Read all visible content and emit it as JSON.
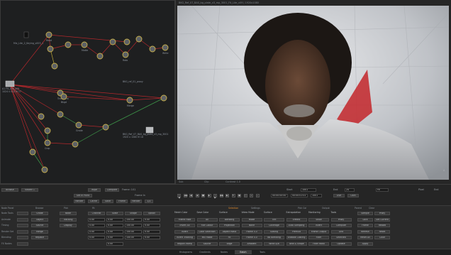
{
  "colors": {
    "accent": "#e08a2c",
    "panel": "#1e1f20",
    "edge_red": "#b2272b",
    "edge_green": "#3f9a4a",
    "edge_yellow": "#b8a234"
  },
  "node_graph": {
    "nodes": [
      "Read",
      "Merge",
      "Transform",
      "Matte",
      "Bkgd",
      "Grade",
      "Roto",
      "Blur",
      "Crop",
      "Write"
    ],
    "info_lines": [
      "Mix_Lite_2_Keying_v003_1",
      "BKG_ref_01_proxy",
      "A1 Flt_Lite_v09",
      "1024 x 512 M 17",
      "BKG_Ref_07_BAS_bg_plate_v3_mp_3001",
      "1920 x 1080 M 16"
    ]
  },
  "viewer": {
    "header_text": "BKG_Ref_07_BAS_bg_plate_v3_mp_3001_Flt_Lite_v09 | 1920x1080",
    "footer_left": "Sub",
    "footer_mid": "Clip",
    "footer_right": "Contrast 1.0",
    "corner_label": "A"
  },
  "transport": {
    "row1": {
      "a": "Browse",
      "b": "Viewer 1",
      "c": "Wipe",
      "d": "Compare",
      "e": "Frame: 101",
      "frame": "1001",
      "fps": "24",
      "zoom": "Fit",
      "start_label": "Start",
      "end_label": "End",
      "pixel_label": "Pixel",
      "last_label": "End"
    },
    "row2": {
      "set": "Set In Point",
      "frame_in": "Frame In",
      "in_value": "00:00:00:00",
      "out_value": "00:00:01:01",
      "range": "1001",
      "right1": "Live",
      "right2": "Gain"
    },
    "row3": {
      "a": "Render",
      "b": "Cache",
      "c": "Save",
      "d": "Frame",
      "e": "Render",
      "f": "1/2"
    }
  },
  "params": {
    "header": [
      "Node Panel",
      "Browse",
      "Pick",
      "Fit",
      "Selection",
      "Settings",
      "Pick Col",
      "Output",
      "Parent",
      "Clear"
    ],
    "rows": [
      {
        "label": "Node Tools",
        "cells": [
          "Grade",
          "Node",
          "Channel",
          "Scale",
          "Shape",
          "Option"
        ]
      },
      {
        "label": "Animate",
        "cells": [
          "Object",
          "Tracking",
          "0.00",
          "0.00",
          "100.00",
          "0.00"
        ]
      },
      {
        "label": "Timing",
        "cells": [
          "Source",
          "Display",
          "0.00",
          "0.00",
          "100.00",
          "0.00"
        ]
      },
      {
        "label": "Render Set",
        "cells": [
          "Merge",
          "",
          "0.00",
          "0.00",
          "100.00",
          "0.00"
        ]
      },
      {
        "label": "Blending",
        "cells": [
          "Replace",
          "",
          "0.00",
          "0.00",
          "100.00",
          "0.00"
        ]
      },
      {
        "label": "FX Nodes",
        "cells": [
          "",
          "",
          "",
          "0.00",
          "",
          ""
        ]
      }
    ],
    "groups": [
      {
        "title": "Match Color",
        "items": [
          "Frame Hold",
          "Invert All",
          "Invert",
          "Invert Tracking",
          "Region Interp"
        ]
      },
      {
        "title": "Save Color",
        "items": [
          "All",
          "Flat Colour",
          "Color Selection",
          "Mix Mode",
          "Source"
        ]
      },
      {
        "title": "Surface",
        "items": [
          "Blending",
          "Projection",
          "Aspect Ratio",
          "Fit",
          "Edge"
        ]
      },
      {
        "title": "Video Mode",
        "items": [
          "Mode",
          "None",
          "Frame 0.0",
          "Frame 0.0",
          "Ambient"
        ]
      },
      {
        "title": "Surface",
        "items": [
          "Tint",
          "Coverage",
          "Scaling",
          "No Blending",
          "Write A/B"
        ]
      },
      {
        "title": "Extrapolation",
        "items": [
          "Effects",
          "Auto Sampling",
          "Premult",
          "Shadow Casting",
          "Tone & Shape"
        ]
      },
      {
        "title": "Monitoring",
        "items": [
          "Show",
          "Invert",
          "Frame Output",
          "Filter",
          "Filter Ratio"
        ]
      },
      {
        "title": "Tools",
        "items": [
          "Proxy",
          "Compute",
          "Grid",
          "Selected",
          "Update"
        ]
      }
    ],
    "right_panel": [
      "Sample",
      "Proxy",
      "Lock",
      "Set Current",
      "Frame",
      "Reload",
      "Refresh",
      "Reset",
      "Reset All",
      "Color",
      "Apply"
    ]
  },
  "bottom_tabs": [
    "Histograms",
    "Gradients",
    "Nodes",
    "Batch",
    "Tools"
  ],
  "bottom_tabs_active": "Batch"
}
